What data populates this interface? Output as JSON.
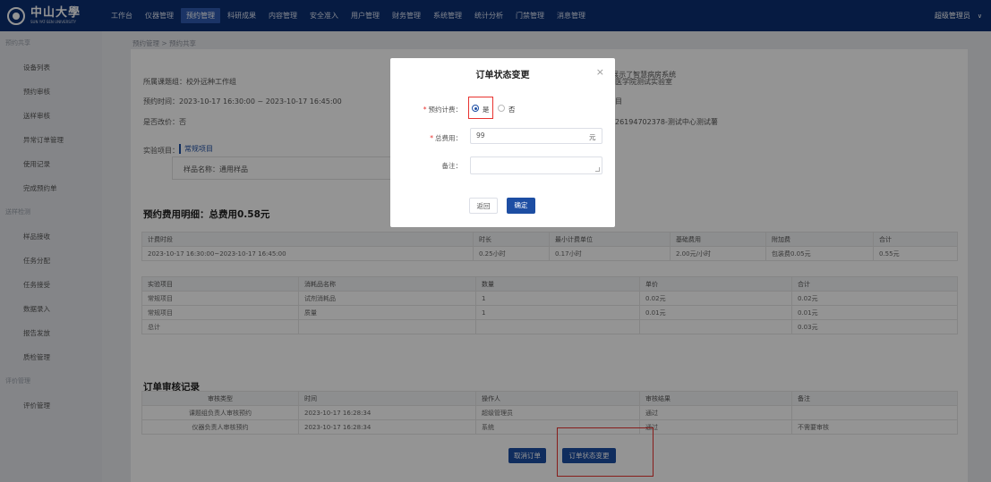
{
  "brand": {
    "name_cn": "中山大學",
    "name_en": "SUN YAT-SEN UNIVERSITY"
  },
  "nav": [
    "工作台",
    "仪器管理",
    "预约管理",
    "科研成果",
    "内容管理",
    "安全准入",
    "用户管理",
    "财务管理",
    "系统管理",
    "统计分析",
    "门禁管理",
    "消息管理"
  ],
  "user": {
    "name": "超级管理员"
  },
  "sidebar": {
    "g1": "预约共享",
    "i1": "设备列表",
    "i2": "预约审核",
    "i3": "送样审核",
    "i4": "异常订单管理",
    "i5": "使用记录",
    "i6": "完成预约单",
    "g2": "送样检测",
    "i7": "样品接收",
    "i8": "任务分配",
    "i9": "任务接受",
    "i10": "数据录入",
    "i11": "报告发放",
    "i12": "质检管理",
    "g3": "评价管理",
    "i13": "评价管理"
  },
  "breadcrumb": "预约管理  >  预约共享",
  "info": {
    "topic": "所属课题组：校外远种工作组",
    "time": "预约时间：2023-10-17 16:30:00 ~ 2023-10-17 16:45:00",
    "modify": "是否改价：否",
    "right1": "2个智能体验区，展示了智慧病房系统",
    "right2": "医学院测试实验室",
    "right3": "目",
    "right4": "26194702378-测试中心测试薯",
    "project_label": "实验项目：",
    "project_tag": "常规项目",
    "sample": "样品名称：通用样品"
  },
  "fee": {
    "title": "预约费用明细：总费用0.58元",
    "headers": [
      "计费时段",
      "时长",
      "最小计费单位",
      "基础费用",
      "附加费",
      "合计"
    ],
    "row": [
      "2023-10-17 16:30:00~2023-10-17 16:45:00",
      "0.25小时",
      "0.17小时",
      "2.00元/小时",
      "包装费0.05元",
      "0.55元"
    ]
  },
  "consumables": {
    "headers": [
      "实验项目",
      "消耗品名称",
      "数量",
      "单价",
      "合计"
    ],
    "rows": [
      [
        "常规项目",
        "试剂消耗品",
        "1",
        "0.02元",
        "0.02元"
      ],
      [
        "常规项目",
        "质量",
        "1",
        "0.01元",
        "0.01元"
      ],
      [
        "总计",
        "",
        "",
        "",
        "0.03元"
      ]
    ]
  },
  "review": {
    "title": "订单审核记录",
    "headers": [
      "审核类型",
      "时间",
      "操作人",
      "审核结果",
      "备注"
    ],
    "rows": [
      [
        "课题组负责人审核预约",
        "2023-10-17 16:28:34",
        "超级管理员",
        "通过",
        ""
      ],
      [
        "仪器负责人审核预约",
        "2023-10-17 16:28:34",
        "系统",
        "通过",
        "不需要审核"
      ]
    ]
  },
  "actions": {
    "cancel": "取消订单",
    "change": "订单状态变更"
  },
  "modal": {
    "title": "订单状态变更",
    "close": "×",
    "billing_label": "预约计费：",
    "yes": "是",
    "no": "否",
    "total_label": "总费用：",
    "total_value": "99",
    "unit": "元",
    "note_label": "备注：",
    "back": "返回",
    "confirm": "确定"
  }
}
